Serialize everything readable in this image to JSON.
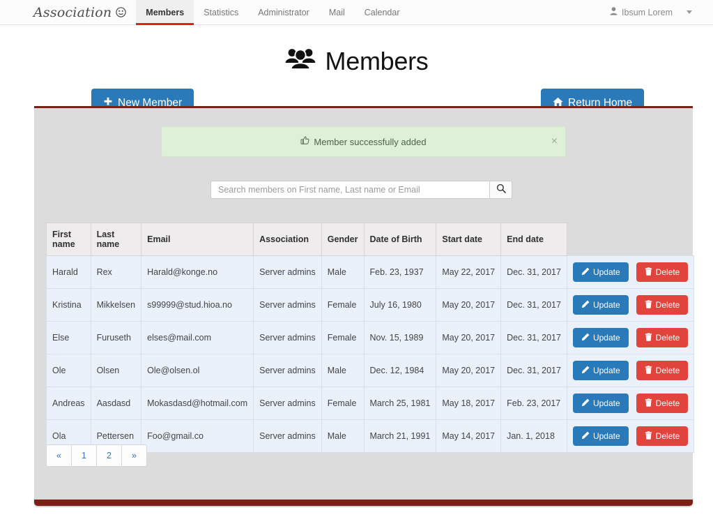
{
  "navbar": {
    "brand": "Association",
    "brand_icon": "circle-face-icon",
    "tabs": [
      {
        "label": "Members",
        "active": true
      },
      {
        "label": "Statistics",
        "active": false
      },
      {
        "label": "Administrator",
        "active": false
      },
      {
        "label": "Mail",
        "active": false
      },
      {
        "label": "Calendar",
        "active": false
      }
    ],
    "user": {
      "name": "Ibsum Lorem",
      "icon": "user-icon",
      "caret": "chevron-down-icon"
    },
    "active_underline_color": "#d9231d"
  },
  "page": {
    "title": "Members",
    "title_icon": "users-group-icon"
  },
  "toolbar": {
    "new_member_label": "New Member",
    "new_member_icon": "plus-icon",
    "return_home_label": "Return Home",
    "return_home_icon": "home-icon",
    "primary_color": "#2a7ab9"
  },
  "alert": {
    "icon": "thumbs-up-icon",
    "message": "Member successfully added",
    "close_label": "×",
    "background": "#dff0d8"
  },
  "search": {
    "value": "",
    "placeholder": "Search members on First name, Last name or Email",
    "button_icon": "search-icon"
  },
  "table": {
    "columns": [
      "First name",
      "Last name",
      "Email",
      "Association",
      "Gender",
      "Date of Birth",
      "Start date",
      "End date"
    ],
    "rows": [
      {
        "first_name": "Harald",
        "last_name": "Rex",
        "email": "Harald@konge.no",
        "association": "Server admins",
        "gender": "Male",
        "dob": "Feb. 23, 1937",
        "start_date": "May 22, 2017",
        "end_date": "Dec. 31, 2017"
      },
      {
        "first_name": "Kristina",
        "last_name": "Mikkelsen",
        "email": "s99999@stud.hioa.no",
        "association": "Server admins",
        "gender": "Female",
        "dob": "July 16, 1980",
        "start_date": "May 20, 2017",
        "end_date": "Dec. 31, 2017"
      },
      {
        "first_name": "Else",
        "last_name": "Furuseth",
        "email": "elses@mail.com",
        "association": "Server admins",
        "gender": "Female",
        "dob": "Nov. 15, 1989",
        "start_date": "May 20, 2017",
        "end_date": "Dec. 31, 2017"
      },
      {
        "first_name": "Ole",
        "last_name": "Olsen",
        "email": "Ole@olsen.ol",
        "association": "Server admins",
        "gender": "Male",
        "dob": "Dec. 12, 1984",
        "start_date": "May 20, 2017",
        "end_date": "Dec. 31, 2017"
      },
      {
        "first_name": "Andreas",
        "last_name": "Aasdasd",
        "email": "Mokasdasd@hotmail.com",
        "association": "Server admins",
        "gender": "Female",
        "dob": "March 25, 1981",
        "start_date": "May 18, 2017",
        "end_date": "Feb. 23, 2017"
      },
      {
        "first_name": "Ola",
        "last_name": "Pettersen",
        "email": "Foo@gmail.co",
        "association": "Server admins",
        "gender": "Male",
        "dob": "March 21, 1991",
        "start_date": "May 14, 2017",
        "end_date": "Jan. 1, 2018"
      }
    ],
    "row_actions": {
      "update_label": "Update",
      "update_icon": "pencil-icon",
      "update_color": "#2a7ab9",
      "delete_label": "Delete",
      "delete_icon": "trash-icon",
      "delete_color": "#e0443c"
    }
  },
  "pagination": {
    "items": [
      "«",
      "1",
      "2",
      "»"
    ]
  },
  "theme": {
    "panel_background": "#dcdcdc",
    "panel_accent": "#7d1f16"
  }
}
